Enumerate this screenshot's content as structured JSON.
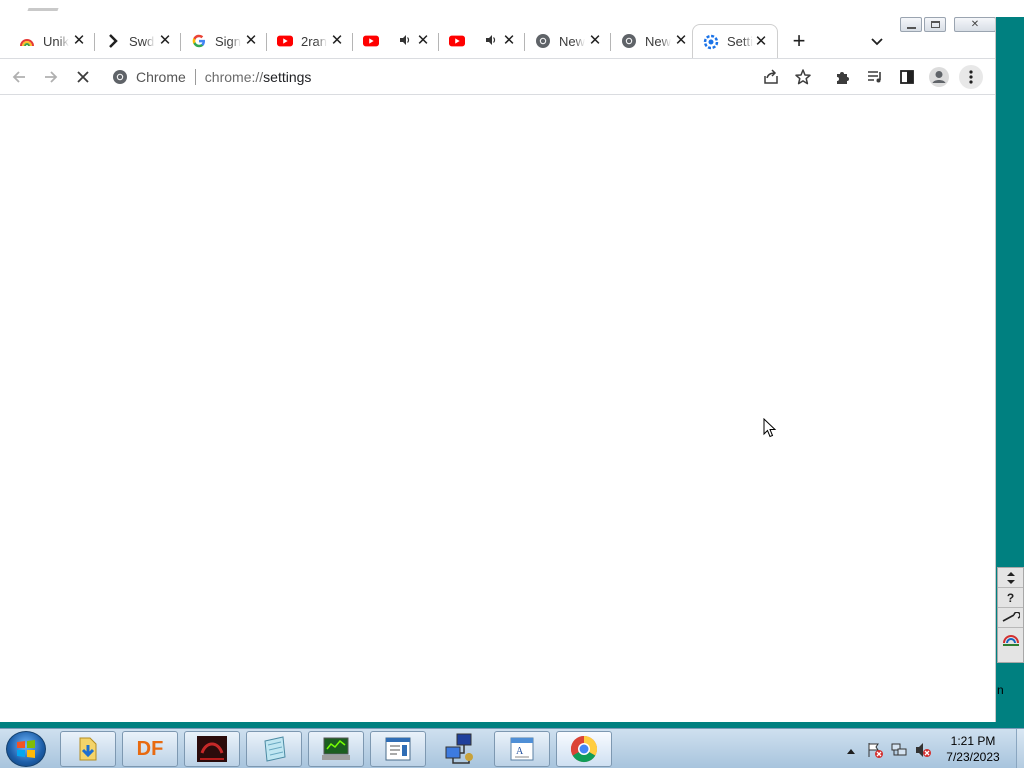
{
  "browser": {
    "tabs": [
      {
        "title": "Unik",
        "favicon": "rainbow-icon",
        "active": false,
        "audio": false
      },
      {
        "title": "Swd",
        "favicon": "arrow-icon",
        "active": false,
        "audio": false
      },
      {
        "title": "Sign",
        "favicon": "google-icon",
        "active": false,
        "audio": false
      },
      {
        "title": "2ran",
        "favicon": "youtube-icon",
        "active": false,
        "audio": false
      },
      {
        "title": "",
        "favicon": "youtube-icon",
        "active": false,
        "audio": true
      },
      {
        "title": "",
        "favicon": "youtube-icon",
        "active": false,
        "audio": true
      },
      {
        "title": "New",
        "favicon": "chrome-icon",
        "active": false,
        "audio": false
      },
      {
        "title": "New",
        "favicon": "chrome-icon",
        "active": false,
        "audio": false
      },
      {
        "title": "Setti",
        "favicon": "settings-icon",
        "active": true,
        "audio": false
      }
    ],
    "new_tab_label": "+",
    "omnibox": {
      "site_name": "Chrome",
      "url_scheme": "chrome://",
      "url_path": "settings"
    },
    "loading": true
  },
  "taskbar": {
    "clock_time": "1:21 PM",
    "clock_date": "7/23/2023",
    "df_label": "DF"
  },
  "side_panel": {
    "help_label": "?",
    "trailing_text": "n"
  },
  "colors": {
    "desktop": "#008080",
    "accent": "#1a73e8",
    "youtube": "#ff0000"
  }
}
